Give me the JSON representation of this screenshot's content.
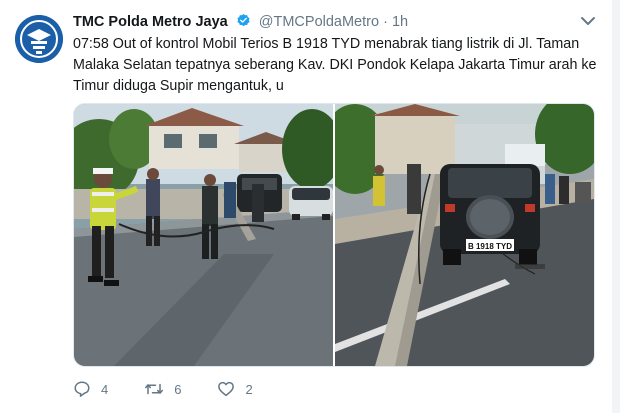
{
  "account": {
    "display_name": "TMC Polda Metro Jaya",
    "handle": "@TMCPoldaMetro",
    "separator": "·",
    "time": "1h",
    "verified": true,
    "avatar_color": "#1b5fa8"
  },
  "tweet": {
    "text": "07:58 Out of kontrol Mobil Terios B 1918 TYD menabrak tiang listrik di Jl. Taman Malaka Selatan tepatnya seberang Kav. DKI Pondok Kelapa Jakarta Timur arah ke Timur diduga Supir mengantuk, u"
  },
  "media": {
    "photos": [
      {
        "label": "police officer directing traffic near fallen pole"
      },
      {
        "label": "car crashed into fallen electric pole"
      }
    ],
    "plate_text": "B 1918 TYD"
  },
  "actions": {
    "replies": "4",
    "retweets": "6",
    "likes": "2"
  },
  "icons": {
    "verified": "verified-badge-icon",
    "caret": "chevron-down-icon",
    "reply": "reply-icon",
    "retweet": "retweet-icon",
    "like": "heart-icon"
  },
  "colors": {
    "text": "#14171a",
    "secondary": "#657786",
    "verified": "#1da1f2"
  }
}
